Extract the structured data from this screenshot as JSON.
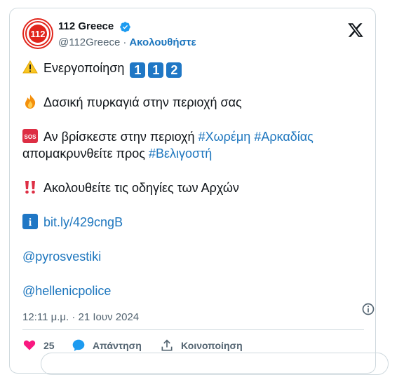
{
  "account": {
    "display_name": "112 Greece",
    "handle": "@112Greece",
    "separator": "·",
    "follow_label": "Ακολουθήστε",
    "avatar_text": "112"
  },
  "tweet": {
    "line1_text": "Ενεργοποίηση",
    "line1_digits": [
      "1",
      "1",
      "2"
    ],
    "line2_text": "Δασική πυρκαγιά στην περιοχή σας",
    "line3_text": "Αν βρίσκεστε στην περιοχή",
    "line3_hashtag1": "#Χωρέμη",
    "line3_hashtag2": "#Αρκαδίας",
    "line4_text": "απομακρυνθείτε προς",
    "line4_hashtag": "#Βελιγοστή",
    "line5_text": "Ακολουθείτε τις οδηγίες των Αρχών",
    "link": "bit.ly/429cngB",
    "mention1": "@pyrosvestiki",
    "mention2": "@hellenicpolice",
    "sos_label": "SOS",
    "info_label": "i"
  },
  "meta": {
    "timestamp": "12:11 μ.μ. · 21 Ιουν 2024"
  },
  "actions": {
    "likes": "25",
    "reply_label": "Απάντηση",
    "share_label": "Κοινοποίηση"
  },
  "icons": [
    "verified-badge-icon",
    "x-logo-icon",
    "warning-icon",
    "fire-icon",
    "sos-icon",
    "double-exclamation-icon",
    "info-icon",
    "heart-icon",
    "reply-bubble-icon",
    "share-icon"
  ],
  "colors": {
    "link": "#1d76be",
    "verified": "#1d9bf0",
    "heart": "#f91880",
    "avatar_red": "#e1251b",
    "number_box": "#1f77c5",
    "muted": "#536471"
  }
}
